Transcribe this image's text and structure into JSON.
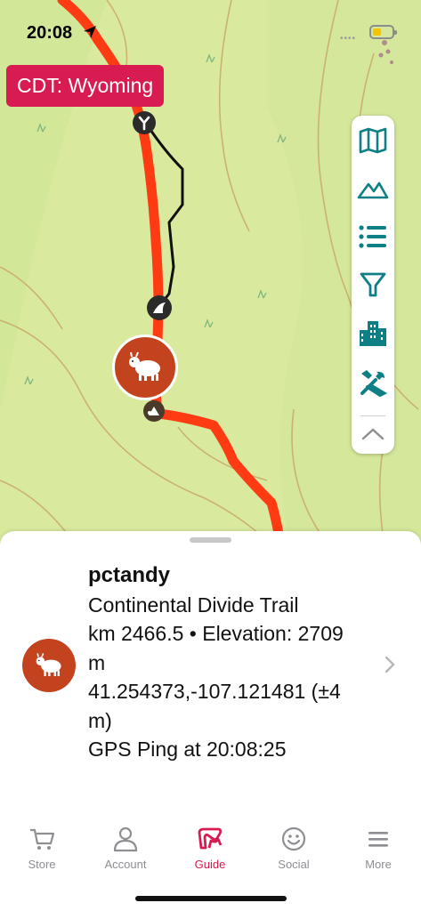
{
  "status": {
    "time": "20:08",
    "signal": "••••"
  },
  "colors": {
    "accent": "#d81b50",
    "trail": "#ff3b14",
    "teal": "#0f7f86",
    "avatar_bg": "#c4431f",
    "map_bg": "#d9ea9e"
  },
  "map": {
    "trail_badge": "CDT: Wyoming",
    "markers": [
      "junction-icon",
      "camp-icon",
      "tent-icon",
      "goat-avatar"
    ]
  },
  "tools": [
    {
      "name": "map-layers-icon"
    },
    {
      "name": "terrain-icon"
    },
    {
      "name": "list-icon"
    },
    {
      "name": "filter-icon"
    },
    {
      "name": "town-icon"
    },
    {
      "name": "tools-icon"
    },
    {
      "name": "chevron-up-icon"
    }
  ],
  "user_card": {
    "username": "pctandy",
    "trail_name": "Continental Divide Trail",
    "distance_elevation": "km 2466.5 • Elevation: 2709 m",
    "coordinates": "41.254373,-107.121481 (±4 m)",
    "gps_ping": "GPS Ping at 20:08:25"
  },
  "tabs": [
    {
      "label": "Store",
      "icon": "cart-icon",
      "active": false
    },
    {
      "label": "Account",
      "icon": "person-icon",
      "active": false
    },
    {
      "label": "Guide",
      "icon": "guide-icon",
      "active": true
    },
    {
      "label": "Social",
      "icon": "smiley-icon",
      "active": false
    },
    {
      "label": "More",
      "icon": "menu-icon",
      "active": false
    }
  ]
}
